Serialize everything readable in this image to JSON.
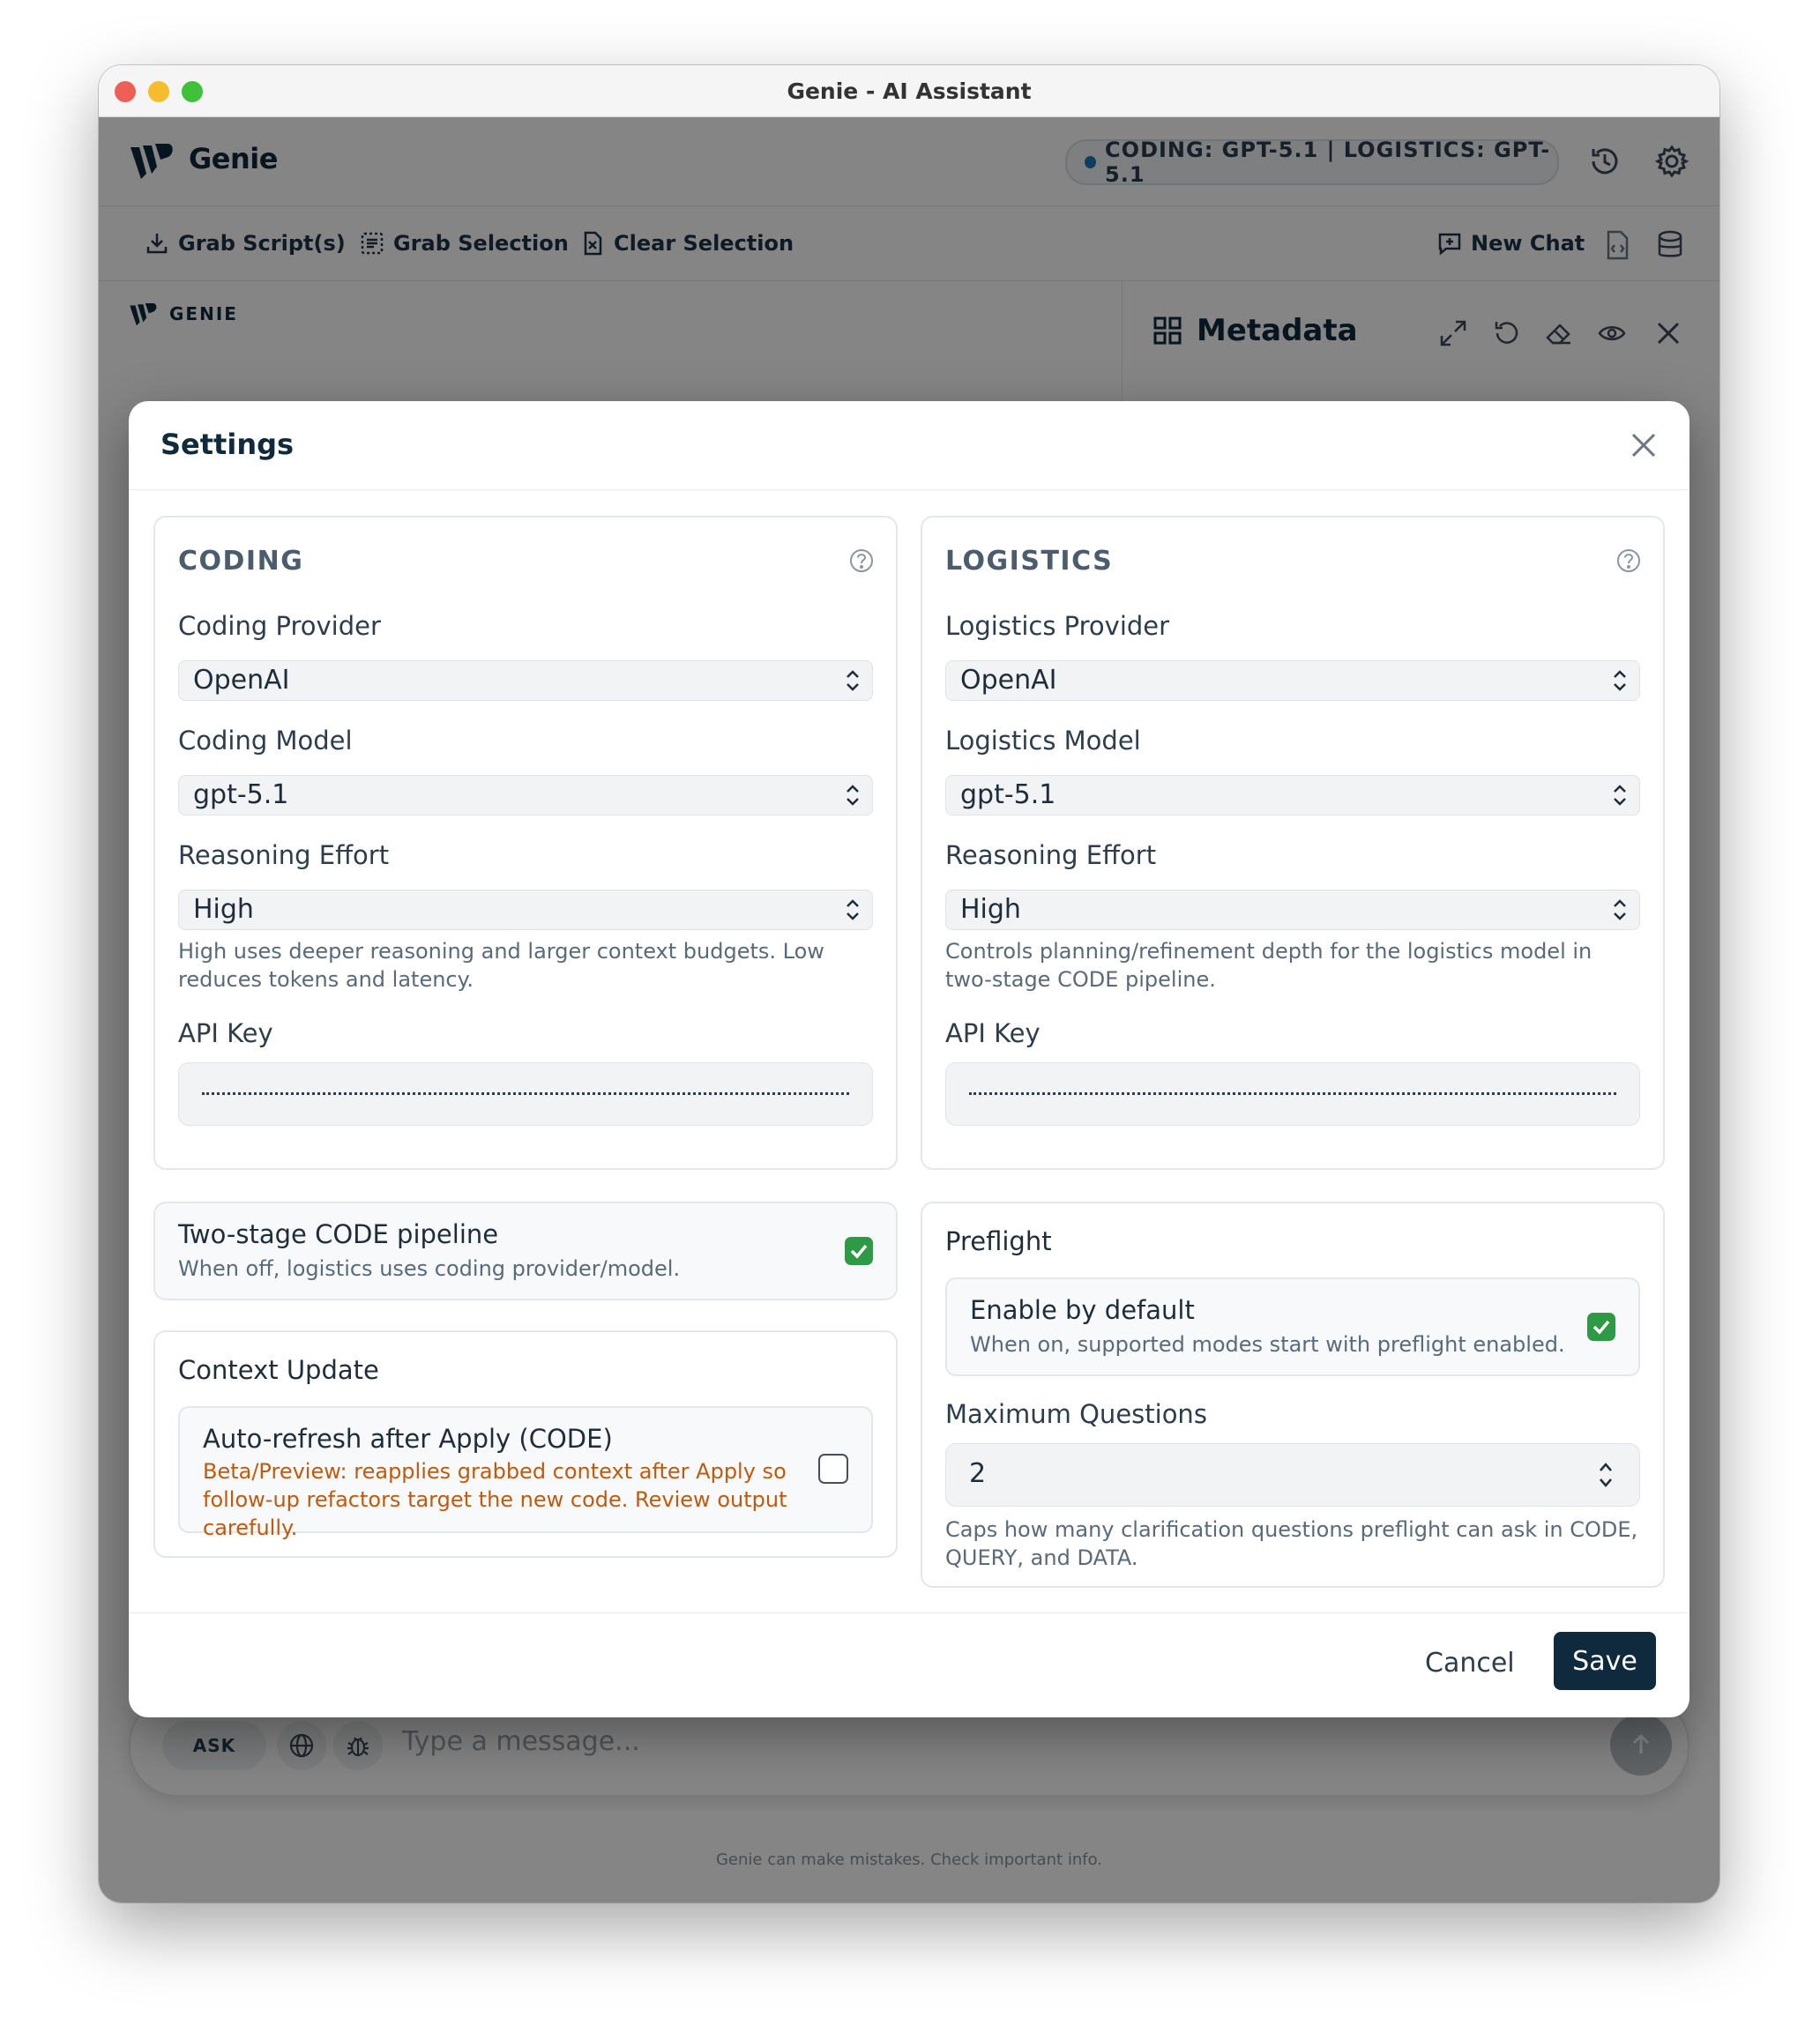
{
  "window": {
    "title": "Genie - AI Assistant"
  },
  "header": {
    "brand": "Genie",
    "status": "CODING: GPT-5.1 | LOGISTICS: GPT-5.1",
    "icons": [
      "history-icon",
      "settings-gear-icon"
    ]
  },
  "toolbar": {
    "grab_scripts": "Grab Script(s)",
    "grab_selection": "Grab Selection",
    "clear_selection": "Clear Selection",
    "new_chat": "New Chat"
  },
  "left_pane": {
    "label": "GENIE"
  },
  "right_pane": {
    "title": "Metadata"
  },
  "composer": {
    "mode": "ASK",
    "placeholder": "Type a message...",
    "footer": "Genie can make mistakes. Check important info."
  },
  "settings": {
    "title": "Settings",
    "coding": {
      "title": "CODING",
      "provider_label": "Coding Provider",
      "provider_value": "OpenAI",
      "model_label": "Coding Model",
      "model_value": "gpt-5.1",
      "effort_label": "Reasoning Effort",
      "effort_value": "High",
      "effort_help": "High uses deeper reasoning and larger context budgets. Low reduces tokens and latency.",
      "api_key_label": "API Key"
    },
    "logistics": {
      "title": "LOGISTICS",
      "provider_label": "Logistics Provider",
      "provider_value": "OpenAI",
      "model_label": "Logistics Model",
      "model_value": "gpt-5.1",
      "effort_label": "Reasoning Effort",
      "effort_value": "High",
      "effort_help": "Controls planning/refinement depth for the logistics model in two-stage CODE pipeline.",
      "api_key_label": "API Key"
    },
    "two_stage": {
      "title": "Two-stage CODE pipeline",
      "subtitle": "When off, logistics uses coding provider/model.",
      "checked": true
    },
    "context_update": {
      "title": "Context Update",
      "option_title": "Auto-refresh after Apply (CODE)",
      "option_warning": "Beta/Preview: reapplies grabbed context after Apply so follow-up refactors target the new code. Review output carefully.",
      "checked": false
    },
    "preflight": {
      "title": "Preflight",
      "enable_title": "Enable by default",
      "enable_subtitle": "When on, supported modes start with preflight enabled.",
      "enabled": true,
      "max_label": "Maximum Questions",
      "max_value": "2",
      "max_help": "Caps how many clarification questions preflight can ask in CODE, QUERY, and DATA."
    },
    "cancel_label": "Cancel",
    "save_label": "Save"
  },
  "colors": {
    "brand_navy": "#0f2a3d",
    "check_green": "#2f9a45",
    "warning_orange": "#c05a0f",
    "status_dot": "#1d75b8"
  }
}
